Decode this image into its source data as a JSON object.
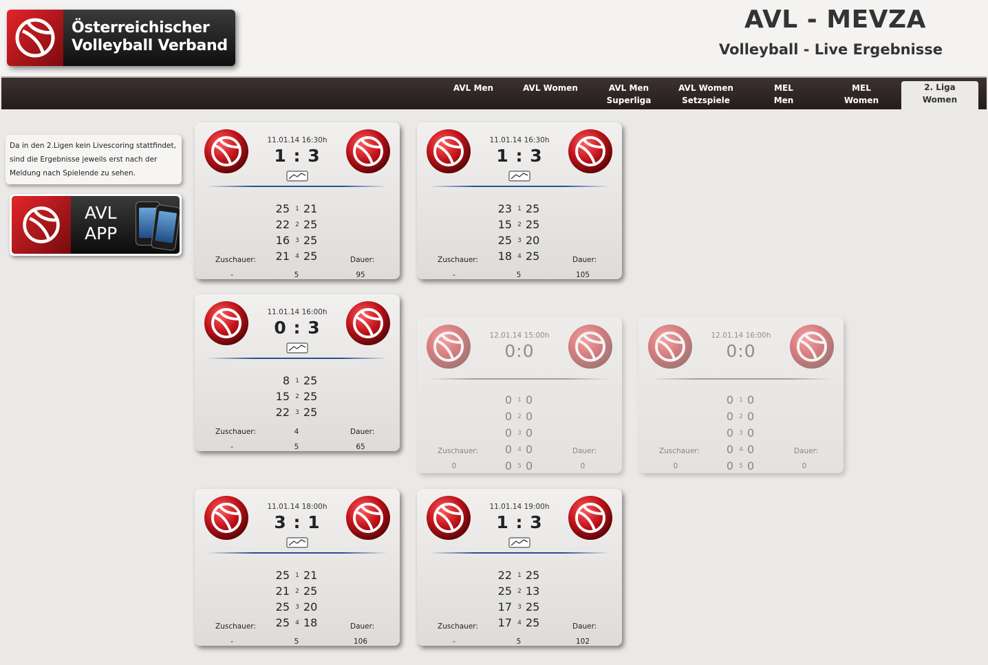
{
  "header": {
    "brand_line1": "Österreichischer",
    "brand_line2": "Volleyball Verband",
    "title": "AVL - MEVZA",
    "subtitle": "Volleyball - Live Ergebnisse"
  },
  "nav": {
    "tabs": [
      {
        "line1": "AVL Men",
        "line2": ""
      },
      {
        "line1": "AVL Women",
        "line2": ""
      },
      {
        "line1": "AVL Men",
        "line2": "Superliga"
      },
      {
        "line1": "AVL Women",
        "line2": "Setzspiele"
      },
      {
        "line1": "MEL",
        "line2": "Men"
      },
      {
        "line1": "MEL",
        "line2": "Women"
      },
      {
        "line1": "2. Liga",
        "line2": "Women"
      }
    ],
    "active_index": 6
  },
  "sidebar": {
    "note": "Da in den 2.Ligen kein Livescoring stattfindet, sind die Ergebnisse jeweils erst nach der Meldung nach Spielende zu sehen.",
    "app_line1": "AVL",
    "app_line2": "APP"
  },
  "colors": {
    "accent_red": "#c8171d",
    "divider_blue": "#2b4f8f",
    "nav_dark": "#2e2625"
  },
  "labels": {
    "spectators": "Zuschauer:",
    "duration": "Dauer:"
  },
  "matches": [
    {
      "date": "11.01.14 16:30h",
      "score": "1 : 3",
      "sets": [
        [
          "25",
          "1",
          "21"
        ],
        [
          "22",
          "2",
          "25"
        ],
        [
          "16",
          "3",
          "25"
        ],
        [
          "21",
          "4",
          "25"
        ]
      ],
      "spectators": "-",
      "sets_count": "5",
      "duration": "95"
    },
    {
      "date": "11.01.14 16:30h",
      "score": "1 : 3",
      "sets": [
        [
          "23",
          "1",
          "25"
        ],
        [
          "15",
          "2",
          "25"
        ],
        [
          "25",
          "3",
          "20"
        ],
        [
          "18",
          "4",
          "25"
        ]
      ],
      "spectators": "-",
      "sets_count": "5",
      "duration": "105"
    },
    {
      "date": "11.01.14 16:00h",
      "score": "0 : 3",
      "sets": [
        [
          "8",
          "1",
          "25"
        ],
        [
          "15",
          "2",
          "25"
        ],
        [
          "22",
          "3",
          "25"
        ]
      ],
      "mid_value": "4",
      "spectators": "-",
      "sets_count": "5",
      "duration": "65"
    },
    {
      "date": "12.01.14 15:00h",
      "score": "0:0",
      "sets": [
        [
          "0",
          "1",
          "0"
        ],
        [
          "0",
          "2",
          "0"
        ],
        [
          "0",
          "3",
          "0"
        ],
        [
          "0",
          "4",
          "0"
        ],
        [
          "0",
          "5",
          "0"
        ]
      ],
      "spectators": "0",
      "duration": "0"
    },
    {
      "date": "12.01.14 16:00h",
      "score": "0:0",
      "sets": [
        [
          "0",
          "1",
          "0"
        ],
        [
          "0",
          "2",
          "0"
        ],
        [
          "0",
          "3",
          "0"
        ],
        [
          "0",
          "4",
          "0"
        ],
        [
          "0",
          "5",
          "0"
        ]
      ],
      "spectators": "0",
      "duration": "0"
    },
    {
      "date": "11.01.14 18:00h",
      "score": "3 : 1",
      "sets": [
        [
          "25",
          "1",
          "21"
        ],
        [
          "21",
          "2",
          "25"
        ],
        [
          "25",
          "3",
          "20"
        ],
        [
          "25",
          "4",
          "18"
        ]
      ],
      "spectators": "-",
      "sets_count": "5",
      "duration": "106"
    },
    {
      "date": "11.01.14 19:00h",
      "score": "1 : 3",
      "sets": [
        [
          "22",
          "1",
          "25"
        ],
        [
          "25",
          "2",
          "13"
        ],
        [
          "17",
          "3",
          "25"
        ],
        [
          "17",
          "4",
          "25"
        ]
      ],
      "spectators": "-",
      "sets_count": "5",
      "duration": "102"
    }
  ]
}
